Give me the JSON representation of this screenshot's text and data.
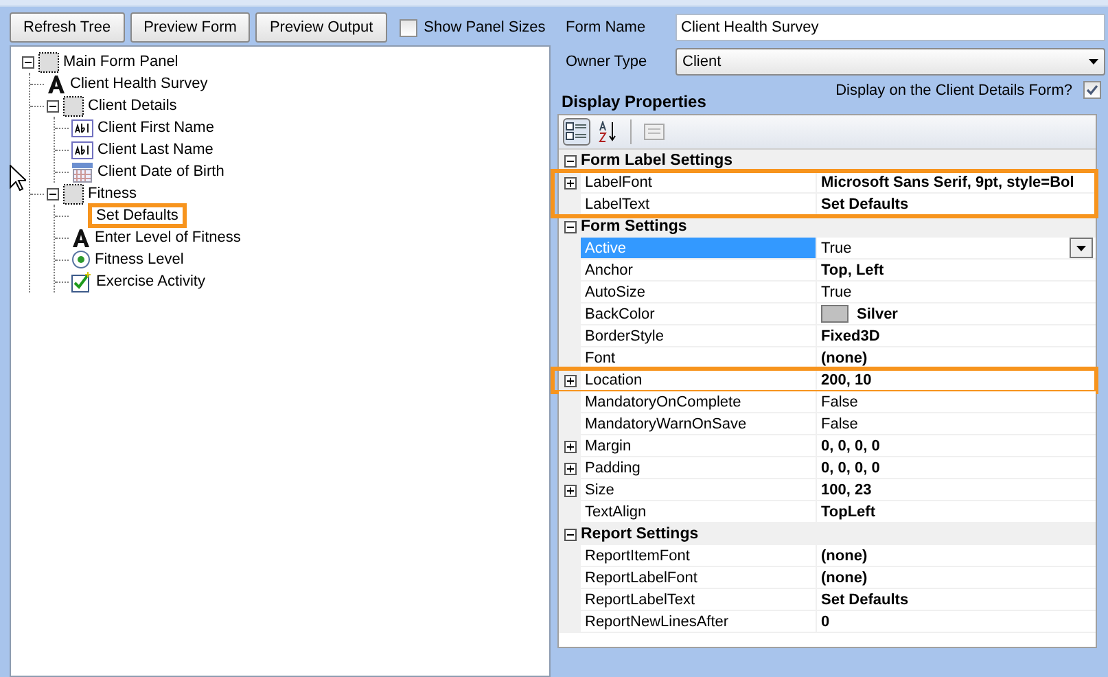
{
  "toolbar": {
    "buttons": [
      "Refresh Tree",
      "Preview Form",
      "Preview Output"
    ],
    "show_panel_sizes": {
      "label": "Show Panel Sizes",
      "checked": false
    }
  },
  "tree": [
    {
      "label": "Main Form Panel",
      "kind": "panel",
      "expanded": true,
      "highlighted": false,
      "children": [
        {
          "label": "Client Health Survey",
          "kind": "label",
          "highlighted": false
        },
        {
          "label": "Client Details",
          "kind": "panel",
          "expanded": true,
          "highlighted": false,
          "children": [
            {
              "label": "Client First Name",
              "kind": "textbox",
              "highlighted": false
            },
            {
              "label": "Client Last Name",
              "kind": "textbox",
              "highlighted": false
            },
            {
              "label": "Client Date of Birth",
              "kind": "date",
              "highlighted": false
            }
          ]
        },
        {
          "label": "Fitness",
          "kind": "panel",
          "expanded": true,
          "highlighted": false,
          "children": [
            {
              "label": "Set Defaults",
              "kind": "blank",
              "highlighted": true
            },
            {
              "label": "Enter Level of Fitness",
              "kind": "label",
              "highlighted": false
            },
            {
              "label": "Fitness Level",
              "kind": "radio",
              "highlighted": false
            },
            {
              "label": "Exercise Activity",
              "kind": "checkbox",
              "highlighted": false
            }
          ]
        }
      ]
    }
  ],
  "form_name": {
    "label": "Form Name",
    "value": "Client Health Survey"
  },
  "owner_type": {
    "label": "Owner Type",
    "value": "Client"
  },
  "display_properties": {
    "title": "Display Properties",
    "display_on_details": {
      "label": "Display on the Client Details Form?",
      "checked": true
    }
  },
  "property_grid": [
    {
      "category": "Form Label Settings",
      "expanded": true,
      "rows": [
        {
          "name": "LabelFont",
          "value": "Microsoft Sans Serif, 9pt, style=Bol",
          "modified": true,
          "expandable": true,
          "selected": false,
          "highlighted": true
        },
        {
          "name": "LabelText",
          "value": "Set Defaults",
          "modified": true,
          "expandable": false,
          "selected": false,
          "highlighted": true
        }
      ]
    },
    {
      "category": "Form Settings",
      "expanded": true,
      "rows": [
        {
          "name": "Active",
          "value": "True",
          "modified": false,
          "expandable": false,
          "selected": true,
          "highlighted": false
        },
        {
          "name": "Anchor",
          "value": "Top, Left",
          "modified": true,
          "expandable": false,
          "selected": false,
          "highlighted": false
        },
        {
          "name": "AutoSize",
          "value": "True",
          "modified": false,
          "expandable": false,
          "selected": false,
          "highlighted": false
        },
        {
          "name": "BackColor",
          "value": "Silver",
          "color": "#c0c0c0",
          "modified": true,
          "expandable": false,
          "selected": false,
          "highlighted": false
        },
        {
          "name": "BorderStyle",
          "value": "Fixed3D",
          "modified": true,
          "expandable": false,
          "selected": false,
          "highlighted": false
        },
        {
          "name": "Font",
          "value": "(none)",
          "modified": true,
          "expandable": false,
          "selected": false,
          "highlighted": false
        },
        {
          "name": "Location",
          "value": "200, 10",
          "modified": true,
          "expandable": true,
          "selected": false,
          "highlighted": true
        },
        {
          "name": "MandatoryOnComplete",
          "value": "False",
          "modified": false,
          "expandable": false,
          "selected": false,
          "highlighted": false
        },
        {
          "name": "MandatoryWarnOnSave",
          "value": "False",
          "modified": false,
          "expandable": false,
          "selected": false,
          "highlighted": false
        },
        {
          "name": "Margin",
          "value": "0, 0, 0, 0",
          "modified": true,
          "expandable": true,
          "selected": false,
          "highlighted": false
        },
        {
          "name": "Padding",
          "value": "0, 0, 0, 0",
          "modified": true,
          "expandable": true,
          "selected": false,
          "highlighted": false
        },
        {
          "name": "Size",
          "value": "100, 23",
          "modified": true,
          "expandable": true,
          "selected": false,
          "highlighted": false
        },
        {
          "name": "TextAlign",
          "value": "TopLeft",
          "modified": true,
          "expandable": false,
          "selected": false,
          "highlighted": false
        }
      ]
    },
    {
      "category": "Report Settings",
      "expanded": true,
      "rows": [
        {
          "name": "ReportItemFont",
          "value": "(none)",
          "modified": true,
          "expandable": false,
          "selected": false,
          "highlighted": false
        },
        {
          "name": "ReportLabelFont",
          "value": "(none)",
          "modified": true,
          "expandable": false,
          "selected": false,
          "highlighted": false
        },
        {
          "name": "ReportLabelText",
          "value": "Set Defaults",
          "modified": true,
          "expandable": false,
          "selected": false,
          "highlighted": false
        },
        {
          "name": "ReportNewLinesAfter",
          "value": "0",
          "modified": true,
          "expandable": false,
          "selected": false,
          "highlighted": false
        }
      ]
    }
  ]
}
